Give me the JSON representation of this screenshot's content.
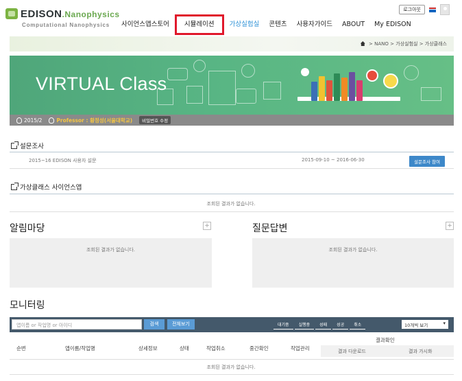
{
  "header": {
    "logo_main": "EDISON",
    "logo_main_suffix": ".Nanophysics",
    "logo_sub": "Computational Nanophysics",
    "logout_label": "로그아웃",
    "nav": [
      {
        "label": "사이언스앱스토어"
      },
      {
        "label": "시뮬레이션"
      },
      {
        "label": "가상실험실"
      },
      {
        "label": "콘텐츠"
      },
      {
        "label": "사용자가이드"
      },
      {
        "label": "ABOUT"
      },
      {
        "label": "My EDISON"
      }
    ]
  },
  "breadcrumb": [
    "NANO",
    "가상실험실",
    "가상클래스"
  ],
  "banner": {
    "title": "VIRTUAL Class",
    "semester": "2015/2",
    "professor": "Professor : 황정성(서울대학교)",
    "password_button": "비밀번호 수정"
  },
  "survey": {
    "title": "설문조사",
    "item_name": "2015~16 EDISON 사용자 설문",
    "item_period": "2015-09-10 ~ 2016-06-30",
    "participate_label": "설문조사 참여"
  },
  "science_apps": {
    "title": "가상클래스 사이언스앱",
    "empty": "조회된 결과가 없습니다."
  },
  "notice": {
    "title": "알림마당",
    "plus": "+",
    "empty": "조회된 결과가 없습니다."
  },
  "qna": {
    "title": "질문답변",
    "plus": "+",
    "empty": "조회된 결과가 없습니다."
  },
  "monitoring": {
    "title": "모니터링",
    "search_placeholder": "앱이름 or 작업명 or 아이디",
    "search_label": "검색",
    "view_all_label": "전체보기",
    "status_tabs": [
      "대기중",
      "실행중",
      "성패",
      "성공",
      "취소"
    ],
    "page_size": "10개씩 보기",
    "columns": [
      "순번",
      "앱이름/작업명",
      "상세정보",
      "상태",
      "작업취소",
      "중간확인",
      "작업관리"
    ],
    "result_group": "결과확인",
    "result_sub": [
      "결과 다운로드",
      "결과 가시화"
    ],
    "empty": "조회된 결과가 없습니다."
  },
  "colors": {
    "accent_blue": "#2a8fd6",
    "banner_green": "#58b584",
    "highlight_red": "#e0182b",
    "monitor_bar": "#44596b"
  }
}
